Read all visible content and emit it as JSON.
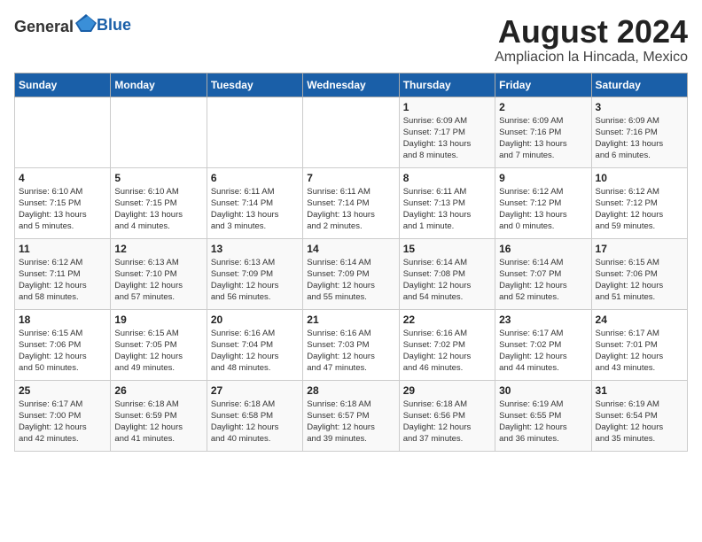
{
  "header": {
    "logo_general": "General",
    "logo_blue": "Blue",
    "month_year": "August 2024",
    "location": "Ampliacion la Hincada, Mexico"
  },
  "days_of_week": [
    "Sunday",
    "Monday",
    "Tuesday",
    "Wednesday",
    "Thursday",
    "Friday",
    "Saturday"
  ],
  "weeks": [
    [
      {
        "day": "",
        "info": ""
      },
      {
        "day": "",
        "info": ""
      },
      {
        "day": "",
        "info": ""
      },
      {
        "day": "",
        "info": ""
      },
      {
        "day": "1",
        "info": "Sunrise: 6:09 AM\nSunset: 7:17 PM\nDaylight: 13 hours\nand 8 minutes."
      },
      {
        "day": "2",
        "info": "Sunrise: 6:09 AM\nSunset: 7:16 PM\nDaylight: 13 hours\nand 7 minutes."
      },
      {
        "day": "3",
        "info": "Sunrise: 6:09 AM\nSunset: 7:16 PM\nDaylight: 13 hours\nand 6 minutes."
      }
    ],
    [
      {
        "day": "4",
        "info": "Sunrise: 6:10 AM\nSunset: 7:15 PM\nDaylight: 13 hours\nand 5 minutes."
      },
      {
        "day": "5",
        "info": "Sunrise: 6:10 AM\nSunset: 7:15 PM\nDaylight: 13 hours\nand 4 minutes."
      },
      {
        "day": "6",
        "info": "Sunrise: 6:11 AM\nSunset: 7:14 PM\nDaylight: 13 hours\nand 3 minutes."
      },
      {
        "day": "7",
        "info": "Sunrise: 6:11 AM\nSunset: 7:14 PM\nDaylight: 13 hours\nand 2 minutes."
      },
      {
        "day": "8",
        "info": "Sunrise: 6:11 AM\nSunset: 7:13 PM\nDaylight: 13 hours\nand 1 minute."
      },
      {
        "day": "9",
        "info": "Sunrise: 6:12 AM\nSunset: 7:12 PM\nDaylight: 13 hours\nand 0 minutes."
      },
      {
        "day": "10",
        "info": "Sunrise: 6:12 AM\nSunset: 7:12 PM\nDaylight: 12 hours\nand 59 minutes."
      }
    ],
    [
      {
        "day": "11",
        "info": "Sunrise: 6:12 AM\nSunset: 7:11 PM\nDaylight: 12 hours\nand 58 minutes."
      },
      {
        "day": "12",
        "info": "Sunrise: 6:13 AM\nSunset: 7:10 PM\nDaylight: 12 hours\nand 57 minutes."
      },
      {
        "day": "13",
        "info": "Sunrise: 6:13 AM\nSunset: 7:09 PM\nDaylight: 12 hours\nand 56 minutes."
      },
      {
        "day": "14",
        "info": "Sunrise: 6:14 AM\nSunset: 7:09 PM\nDaylight: 12 hours\nand 55 minutes."
      },
      {
        "day": "15",
        "info": "Sunrise: 6:14 AM\nSunset: 7:08 PM\nDaylight: 12 hours\nand 54 minutes."
      },
      {
        "day": "16",
        "info": "Sunrise: 6:14 AM\nSunset: 7:07 PM\nDaylight: 12 hours\nand 52 minutes."
      },
      {
        "day": "17",
        "info": "Sunrise: 6:15 AM\nSunset: 7:06 PM\nDaylight: 12 hours\nand 51 minutes."
      }
    ],
    [
      {
        "day": "18",
        "info": "Sunrise: 6:15 AM\nSunset: 7:06 PM\nDaylight: 12 hours\nand 50 minutes."
      },
      {
        "day": "19",
        "info": "Sunrise: 6:15 AM\nSunset: 7:05 PM\nDaylight: 12 hours\nand 49 minutes."
      },
      {
        "day": "20",
        "info": "Sunrise: 6:16 AM\nSunset: 7:04 PM\nDaylight: 12 hours\nand 48 minutes."
      },
      {
        "day": "21",
        "info": "Sunrise: 6:16 AM\nSunset: 7:03 PM\nDaylight: 12 hours\nand 47 minutes."
      },
      {
        "day": "22",
        "info": "Sunrise: 6:16 AM\nSunset: 7:02 PM\nDaylight: 12 hours\nand 46 minutes."
      },
      {
        "day": "23",
        "info": "Sunrise: 6:17 AM\nSunset: 7:02 PM\nDaylight: 12 hours\nand 44 minutes."
      },
      {
        "day": "24",
        "info": "Sunrise: 6:17 AM\nSunset: 7:01 PM\nDaylight: 12 hours\nand 43 minutes."
      }
    ],
    [
      {
        "day": "25",
        "info": "Sunrise: 6:17 AM\nSunset: 7:00 PM\nDaylight: 12 hours\nand 42 minutes."
      },
      {
        "day": "26",
        "info": "Sunrise: 6:18 AM\nSunset: 6:59 PM\nDaylight: 12 hours\nand 41 minutes."
      },
      {
        "day": "27",
        "info": "Sunrise: 6:18 AM\nSunset: 6:58 PM\nDaylight: 12 hours\nand 40 minutes."
      },
      {
        "day": "28",
        "info": "Sunrise: 6:18 AM\nSunset: 6:57 PM\nDaylight: 12 hours\nand 39 minutes."
      },
      {
        "day": "29",
        "info": "Sunrise: 6:18 AM\nSunset: 6:56 PM\nDaylight: 12 hours\nand 37 minutes."
      },
      {
        "day": "30",
        "info": "Sunrise: 6:19 AM\nSunset: 6:55 PM\nDaylight: 12 hours\nand 36 minutes."
      },
      {
        "day": "31",
        "info": "Sunrise: 6:19 AM\nSunset: 6:54 PM\nDaylight: 12 hours\nand 35 minutes."
      }
    ]
  ]
}
